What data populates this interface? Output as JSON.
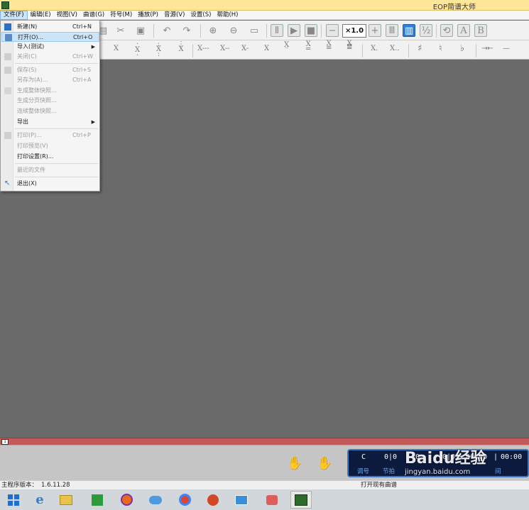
{
  "window": {
    "title": "EOP简谱大师"
  },
  "menubar": [
    {
      "label": "文件(F)",
      "active": true
    },
    {
      "label": "编辑(E)"
    },
    {
      "label": "视图(V)"
    },
    {
      "label": "曲谱(G)"
    },
    {
      "label": "符号(M)"
    },
    {
      "label": "播放(P)"
    },
    {
      "label": "音源(V)"
    },
    {
      "label": "设置(S)"
    },
    {
      "label": "帮助(H)"
    }
  ],
  "toolbar": {
    "speed": "×1.0"
  },
  "file_menu": {
    "items": [
      {
        "label": "新建(N)",
        "shortcut": "Ctrl+N",
        "enabled": true
      },
      {
        "label": "打开(O)...",
        "shortcut": "Ctrl+O",
        "enabled": true,
        "highlighted": true
      },
      {
        "label": "导入(测试)",
        "shortcut": "",
        "enabled": true,
        "submenu": true
      },
      {
        "label": "关闭(C)",
        "shortcut": "Ctrl+W",
        "enabled": false
      },
      {
        "label": "保存(S)",
        "shortcut": "Ctrl+S",
        "enabled": false
      },
      {
        "label": "另存为(A)...",
        "shortcut": "Ctrl+A",
        "enabled": false
      },
      {
        "label": "生成整体快照...",
        "shortcut": "",
        "enabled": false
      },
      {
        "label": "生成分页快照...",
        "shortcut": "",
        "enabled": false
      },
      {
        "label": "连续整体快照...",
        "shortcut": "",
        "enabled": false
      },
      {
        "label": "导出",
        "shortcut": "",
        "enabled": true,
        "submenu": true
      },
      {
        "label": "打印(P)...",
        "shortcut": "Ctrl+P",
        "enabled": false
      },
      {
        "label": "打印预览(V)",
        "shortcut": "",
        "enabled": false
      },
      {
        "label": "打印设置(R)...",
        "shortcut": "",
        "enabled": true
      },
      {
        "label": "最近的文件",
        "shortcut": "",
        "enabled": false
      },
      {
        "label": "退出(X)",
        "shortcut": "",
        "enabled": true
      }
    ]
  },
  "score_strip": {
    "page": "1"
  },
  "display": {
    "key_value": "C",
    "beat_value": "0|0",
    "v3": "0",
    "v4": "0|0",
    "time_current": "00:00",
    "time_total": "00:00",
    "key_label": "调号",
    "beat_label": "节拍",
    "time_label": "间"
  },
  "status": {
    "version_label": "主程序版本：",
    "version": "1.6.11.28",
    "message": "打开现有曲谱"
  },
  "watermark": {
    "brand": "Baidu经验",
    "url": "jingyan.baidu.com"
  },
  "icons": {
    "toolbar": [
      "cut-icon",
      "paste-icon",
      "undo-icon",
      "redo-icon",
      "zoom-in-icon",
      "zoom-out-icon",
      "page-icon",
      "pause-icon",
      "play-icon",
      "stop-icon",
      "minus-icon",
      "plus-icon",
      "metronome-icon",
      "equalizer-icon",
      "mixer-icon",
      "refresh-icon",
      "font-a-icon",
      "font-b-icon"
    ],
    "taskbar": [
      "windows-start-icon",
      "ie-icon",
      "file-explorer-icon",
      "store-icon",
      "firefox-icon",
      "cloud-icon",
      "chrome-icon",
      "powerpoint-icon",
      "image-viewer-icon",
      "paint-icon",
      "eop-app-icon"
    ]
  }
}
